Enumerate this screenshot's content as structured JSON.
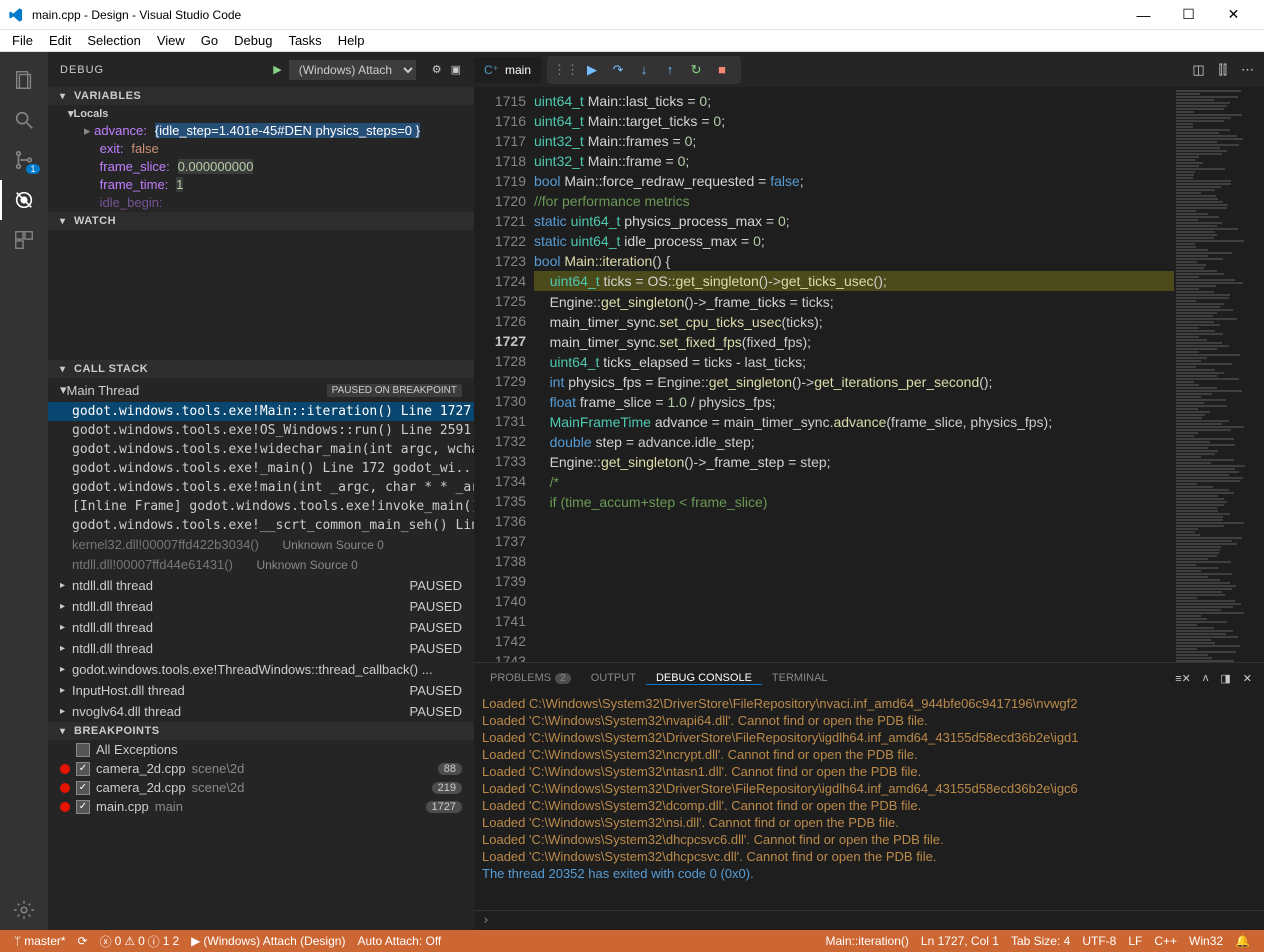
{
  "title": "main.cpp - Design - Visual Studio Code",
  "menu": [
    "File",
    "Edit",
    "Selection",
    "View",
    "Go",
    "Debug",
    "Tasks",
    "Help"
  ],
  "activity_badge": "1",
  "sidebar": {
    "title": "DEBUG",
    "config": "(Windows) Attach",
    "sections": {
      "variables": "VARIABLES",
      "locals": "Locals",
      "watch": "WATCH",
      "callstack": "CALL STACK",
      "breakpoints": "BREAKPOINTS"
    },
    "vars": {
      "advance_k": "advance:",
      "advance_v": "{idle_step=1.401e-45#DEN physics_steps=0 }",
      "exit_k": "exit:",
      "exit_v": "false",
      "frame_slice_k": "frame_slice:",
      "frame_slice_v": "0.000000000",
      "frame_time_k": "frame_time:",
      "frame_time_v": "1",
      "idle_begin_k": "idle_begin:"
    },
    "stack": {
      "thread": "Main Thread",
      "thread_status": "PAUSED ON BREAKPOINT",
      "frames": [
        "godot.windows.tools.exe!Main::iteration() Line 1727",
        "godot.windows.tools.exe!OS_Windows::run() Line 2591",
        "godot.windows.tools.exe!widechar_main(int argc, wcha",
        "godot.windows.tools.exe!_main() Line 172  godot_wi...",
        "godot.windows.tools.exe!main(int _argc, char * * _ar",
        "[Inline Frame] godot.windows.tools.exe!invoke_main()",
        "godot.windows.tools.exe!__scrt_common_main_seh() Lin"
      ],
      "dim1": "kernel32.dll!00007ffd422b3034()",
      "dim1_src": "Unknown Source  0",
      "dim2": "ntdll.dll!00007ffd44e61431()",
      "dim2_src": "Unknown Source  0",
      "threads": [
        {
          "name": "ntdll.dll thread",
          "status": "PAUSED"
        },
        {
          "name": "ntdll.dll thread",
          "status": "PAUSED"
        },
        {
          "name": "ntdll.dll thread",
          "status": "PAUSED"
        },
        {
          "name": "ntdll.dll thread",
          "status": "PAUSED"
        },
        {
          "name": "godot.windows.tools.exe!ThreadWindows::thread_callback​() ...",
          "status": ""
        },
        {
          "name": "InputHost.dll thread",
          "status": "PAUSED"
        },
        {
          "name": "nvoglv64.dll thread",
          "status": "PAUSED"
        }
      ]
    },
    "breakpoints": {
      "all_exc": "All Exceptions",
      "items": [
        {
          "file": "camera_2d.cpp",
          "path": "scene\\2d",
          "line": "88"
        },
        {
          "file": "camera_2d.cpp",
          "path": "scene\\2d",
          "line": "219"
        },
        {
          "file": "main.cpp",
          "path": "main",
          "line": "1727"
        }
      ]
    }
  },
  "editor": {
    "tab_name": "main",
    "first_line": 1715,
    "bp_line": 1727
  },
  "panel": {
    "tabs": {
      "problems": "PROBLEMS",
      "problems_n": "2",
      "output": "OUTPUT",
      "debug": "DEBUG CONSOLE",
      "terminal": "TERMINAL"
    },
    "lines": [
      "Loaded  C:\\Windows\\System32\\DriverStore\\FileRepository\\nvaci.inf_amd64_944bfe06c9417196\\nvwgf2",
      "Loaded 'C:\\Windows\\System32\\nvapi64.dll'. Cannot find or open the PDB file.",
      "Loaded 'C:\\Windows\\System32\\DriverStore\\FileRepository\\igdlh64.inf_amd64_43155d58ecd36b2e\\igd1",
      "Loaded 'C:\\Windows\\System32\\ncrypt.dll'. Cannot find or open the PDB file.",
      "Loaded 'C:\\Windows\\System32\\ntasn1.dll'. Cannot find or open the PDB file.",
      "Loaded 'C:\\Windows\\System32\\DriverStore\\FileRepository\\igdlh64.inf_amd64_43155d58ecd36b2e\\igc6",
      "Loaded 'C:\\Windows\\System32\\dcomp.dll'. Cannot find or open the PDB file.",
      "Loaded 'C:\\Windows\\System32\\nsi.dll'. Cannot find or open the PDB file.",
      "Loaded 'C:\\Windows\\System32\\dhcpcsvc6.dll'. Cannot find or open the PDB file.",
      "Loaded 'C:\\Windows\\System32\\dhcpcsvc.dll'. Cannot find or open the PDB file."
    ],
    "exit_line": "The thread 20352 has exited with code 0 (0x0)."
  },
  "status": {
    "branch": "master*",
    "errors": "0",
    "warn_a": "0",
    "warn_b": "1",
    "info": "2",
    "attach": "(Windows) Attach (Design)",
    "autoattach": "Auto Attach: Off",
    "fn": "Main::iteration()",
    "pos": "Ln 1727, Col 1",
    "tab": "Tab Size: 4",
    "enc": "UTF-8",
    "eol": "LF",
    "lang": "C++",
    "win": "Win32",
    "bell": "🔔"
  }
}
